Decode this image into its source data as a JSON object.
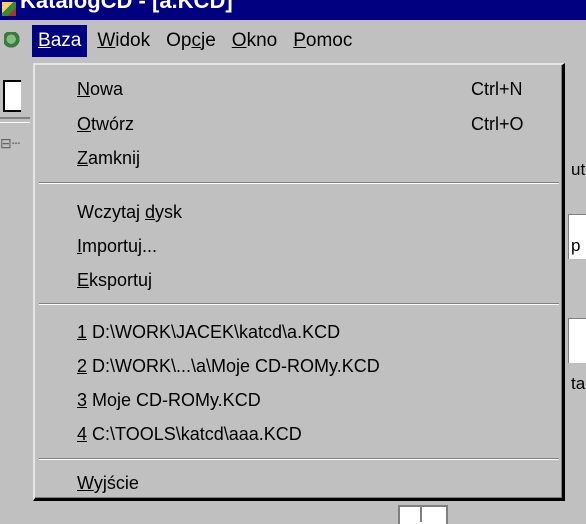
{
  "window": {
    "title": "KatalogCD - [a.KCD]"
  },
  "menubar": {
    "items": [
      {
        "key": "B",
        "rest": "aza"
      },
      {
        "key": "W",
        "rest": "idok"
      },
      {
        "pre": "Op",
        "key": "c",
        "rest": "je"
      },
      {
        "key": "O",
        "rest": "kno"
      },
      {
        "key": "P",
        "rest": "omoc"
      }
    ]
  },
  "menu": {
    "items": [
      {
        "pre": "",
        "key": "N",
        "rest": "owa",
        "shortcut": "Ctrl+N"
      },
      {
        "pre": "",
        "key": "O",
        "rest": "twórz",
        "shortcut": "Ctrl+O"
      },
      {
        "pre": "",
        "key": "Z",
        "rest": "amknij",
        "shortcut": ""
      },
      {
        "pre": "Wczytaj ",
        "key": "d",
        "rest": "ysk",
        "shortcut": ""
      },
      {
        "pre": "",
        "key": "I",
        "rest": "mportuj...",
        "shortcut": ""
      },
      {
        "pre": "",
        "key": "E",
        "rest": "ksportuj",
        "shortcut": ""
      },
      {
        "pre": "",
        "key": "1",
        "rest": " D:\\WORK\\JACEK\\katcd\\a.KCD",
        "shortcut": ""
      },
      {
        "pre": "",
        "key": "2",
        "rest": " D:\\WORK\\...\\a\\Moje CD-ROMy.KCD",
        "shortcut": ""
      },
      {
        "pre": "",
        "key": "3",
        "rest": " Moje CD-ROMy.KCD",
        "shortcut": ""
      },
      {
        "pre": "",
        "key": "4",
        "rest": " C:\\TOOLS\\katcd\\aaa.KCD",
        "shortcut": ""
      },
      {
        "pre": "",
        "key": "W",
        "rest": "yjście",
        "shortcut": ""
      }
    ]
  },
  "background": {
    "right_fragments": [
      "ut",
      "p",
      "ta"
    ]
  }
}
